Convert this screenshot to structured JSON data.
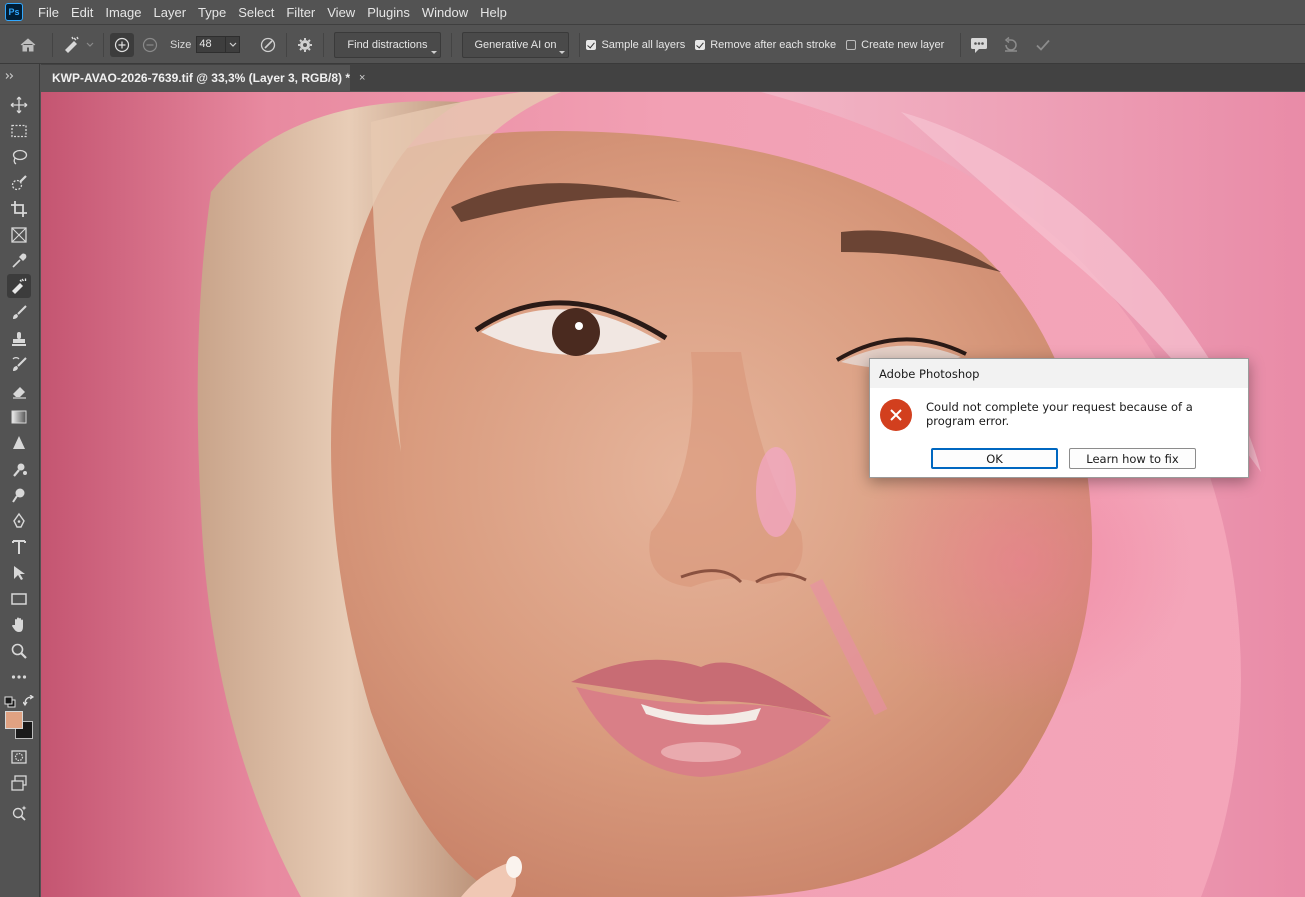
{
  "app": {
    "logo_text": "Ps"
  },
  "menu": [
    "File",
    "Edit",
    "Image",
    "Layer",
    "Type",
    "Select",
    "Filter",
    "View",
    "Plugins",
    "Window",
    "Help"
  ],
  "options": {
    "size_label": "Size",
    "size_value": "48",
    "find_distractions": "Find distractions",
    "generative_ai": "Generative AI on",
    "sample_all_layers": {
      "label": "Sample all layers",
      "checked": true
    },
    "remove_after_stroke": {
      "label": "Remove after each stroke",
      "checked": true
    },
    "create_new_layer": {
      "label": "Create new layer",
      "checked": false
    }
  },
  "document": {
    "tab_title": "KWP-AVAO-2026-7639.tif @ 33,3% (Layer 3, RGB/8) *",
    "close_glyph": "×"
  },
  "dialog": {
    "title": "Adobe Photoshop",
    "message": "Could not complete your request because of a program error.",
    "ok_label": "OK",
    "learn_label": "Learn how to fix"
  },
  "colors": {
    "foreground": "#e0a282",
    "background": "#1a1a1a",
    "error_red": "#d23f1e",
    "focus_blue": "#0067c0"
  },
  "tools": [
    "move-tool",
    "marquee-tool",
    "lasso-tool",
    "quick-selection-tool",
    "crop-tool",
    "frame-tool",
    "eyedropper-tool",
    "remove-tool",
    "brush-tool",
    "stamp-tool",
    "history-brush-tool",
    "eraser-tool",
    "gradient-tool",
    "blur-tool",
    "smudge-tool",
    "dodge-tool",
    "pen-tool",
    "type-tool",
    "path-selection-tool",
    "rectangle-tool",
    "hand-tool",
    "zoom-tool",
    "more-tools"
  ]
}
